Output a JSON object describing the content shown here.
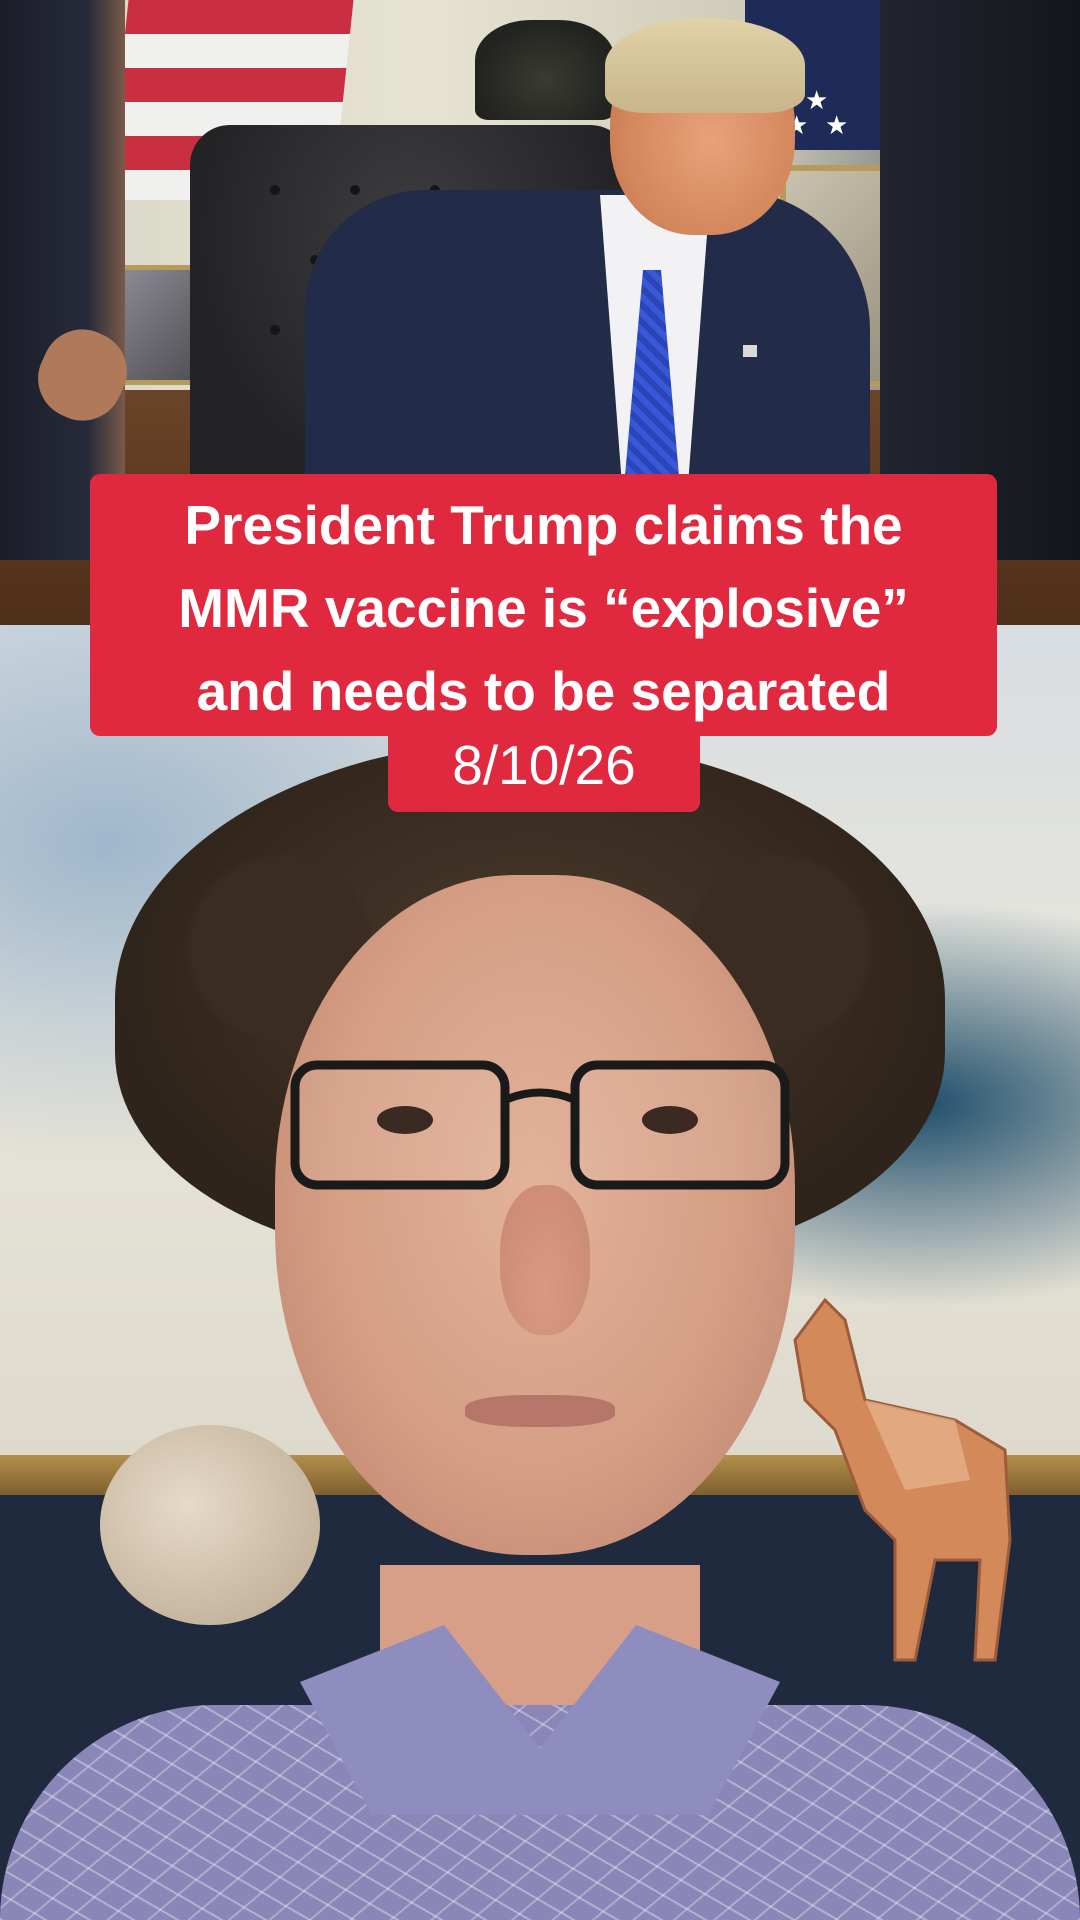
{
  "caption": {
    "lines": [
      "President Trump claims the",
      "MMR vaccine is “explosive”",
      "and needs to be separated"
    ],
    "date": "8/10/26",
    "background_color": "#e0293f",
    "text_color": "#ffffff"
  },
  "top_clip": {
    "icon": "press-event-video-frame"
  },
  "bottom_clip": {
    "icon": "creator-webcam-video-frame"
  }
}
